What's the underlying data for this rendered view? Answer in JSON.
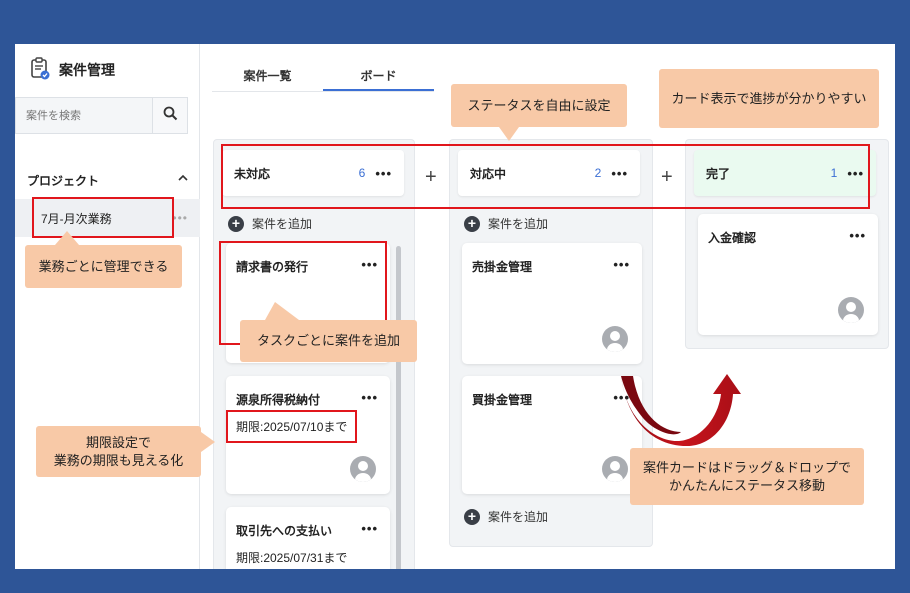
{
  "app": {
    "title": "案件管理",
    "icon": "clipboard-check-icon"
  },
  "search": {
    "placeholder": "案件を検索",
    "icon": "search-icon"
  },
  "sidebar": {
    "section_label": "プロジェクト",
    "items": [
      {
        "label": "7月-月次業務"
      }
    ]
  },
  "tabs": [
    {
      "label": "案件一覧",
      "active": false
    },
    {
      "label": "ボード",
      "active": true
    }
  ],
  "columns": [
    {
      "name": "未対応",
      "count": "6",
      "add_label": "案件を追加",
      "cards": [
        {
          "title": "請求書の発行"
        },
        {
          "title": "源泉所得税納付",
          "due": "期限:2025/07/10まで"
        },
        {
          "title": "取引先への支払い",
          "due": "期限:2025/07/31まで"
        }
      ]
    },
    {
      "name": "対応中",
      "count": "2",
      "add_label": "案件を追加",
      "add_label_bottom": "案件を追加",
      "cards": [
        {
          "title": "売掛金管理"
        },
        {
          "title": "買掛金管理"
        }
      ]
    },
    {
      "name": "完了",
      "count": "1",
      "header_color": "#eafaf0",
      "cards": [
        {
          "title": "入金確認"
        }
      ]
    }
  ],
  "callouts": {
    "status": "ステータスを自由に設定",
    "card_view": "カード表示で進捗が分かりやすい",
    "project": "業務ごとに管理できる",
    "task": "タスクごとに案件を追加",
    "deadline_line1": "期限設定で",
    "deadline_line2": "業務の期限も見える化",
    "drag_line1": "案件カードはドラッグ＆ドロップで",
    "drag_line2": "かんたんにステータス移動"
  },
  "colors": {
    "background": "#2e5597",
    "callout": "#f8c9a7",
    "highlight": "#e1161c",
    "accent": "#3b6fd4",
    "arrow": "#b5101a"
  }
}
